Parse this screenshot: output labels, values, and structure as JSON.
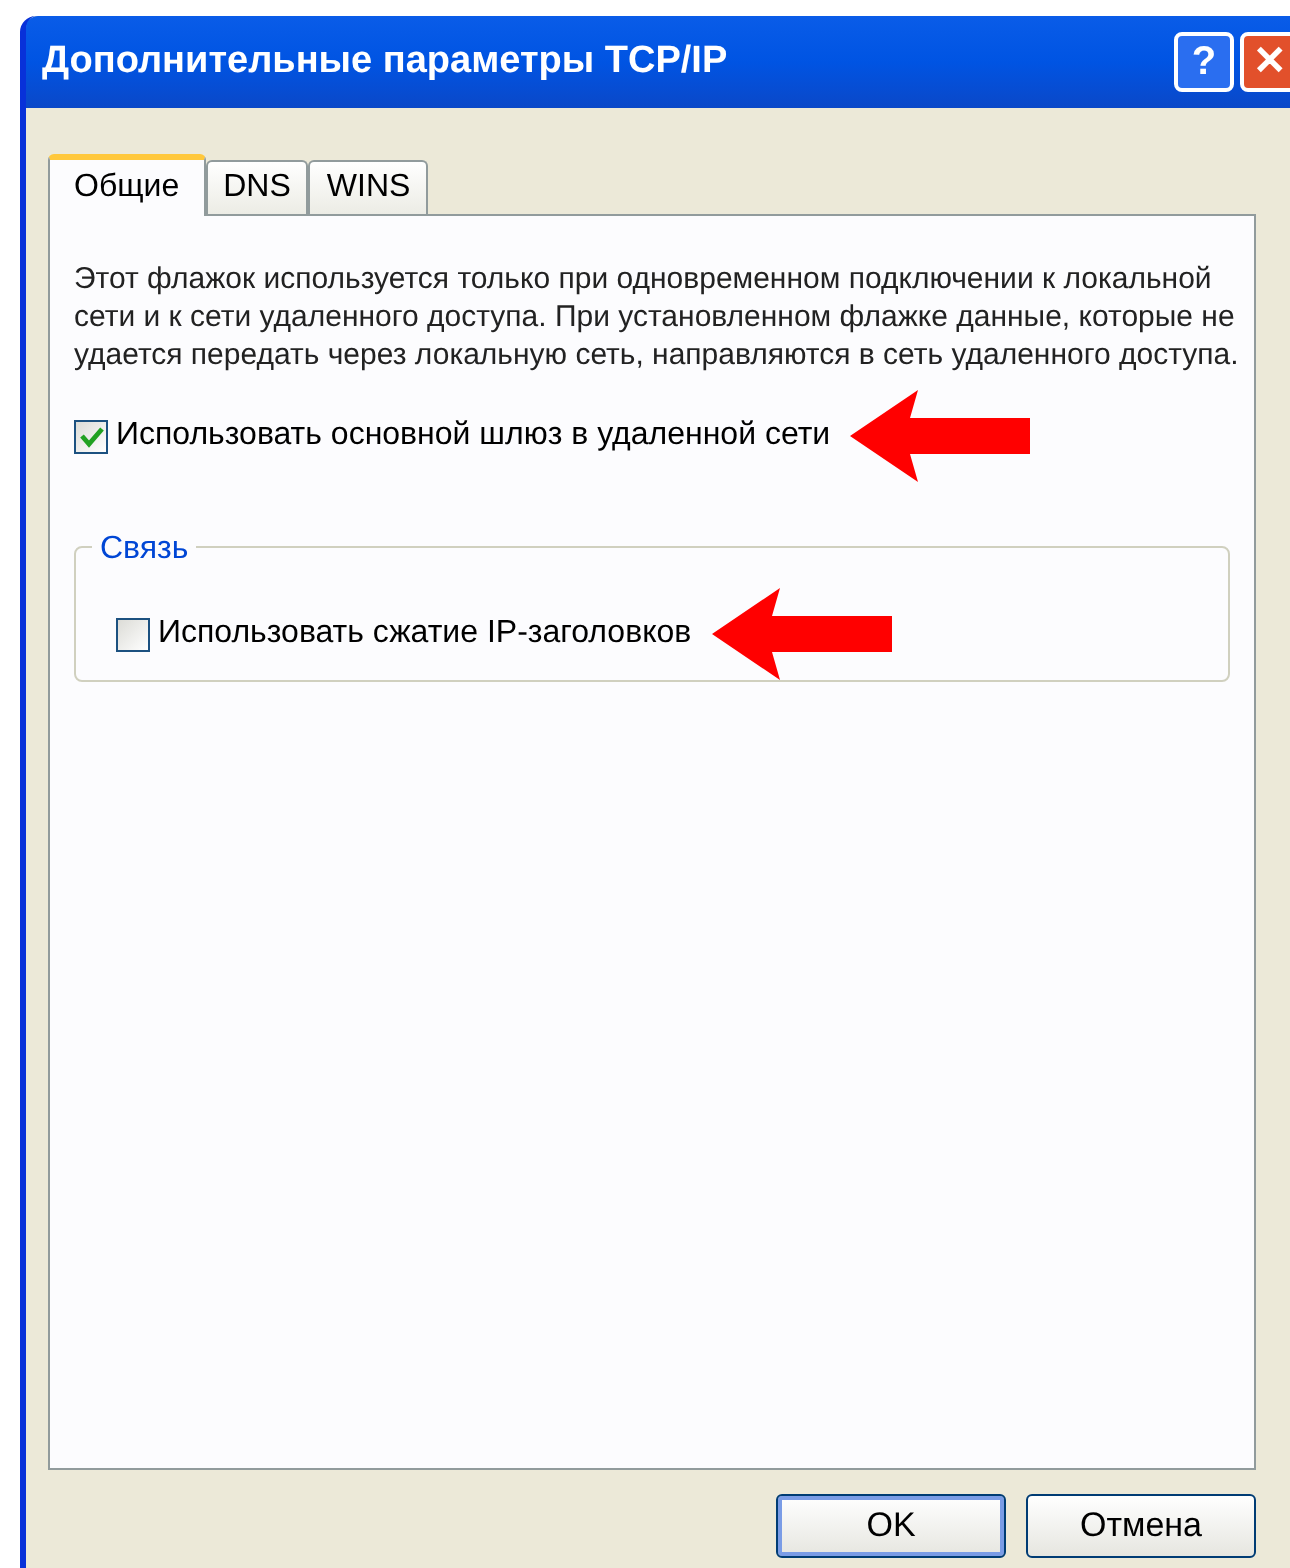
{
  "window": {
    "title": "Дополнительные параметры TCP/IP"
  },
  "title_buttons": [
    {
      "kind": "help",
      "label": "?"
    },
    {
      "kind": "close",
      "label": "✕"
    }
  ],
  "tabs": [
    {
      "label": "Общие",
      "selected": true
    },
    {
      "label": "DNS",
      "selected": false
    },
    {
      "label": "WINS",
      "selected": false
    }
  ],
  "description": "Этот флажок используется только при одновременном подключении к локальной сети и к сети удаленного доступа. При установленном флажке данные, которые не удается передать через локальную сеть, направляются в сеть удаленного доступа.",
  "gateway_checkbox": {
    "label": "Использовать основной шлюз в удаленной сети",
    "checked": true
  },
  "group": {
    "title": "Связь",
    "checkbox": {
      "label": "Использовать сжатие IP-заголовков",
      "checked": false
    }
  },
  "buttons": [
    {
      "label": "OK",
      "default": true
    },
    {
      "label": "Отмена",
      "default": false
    }
  ]
}
